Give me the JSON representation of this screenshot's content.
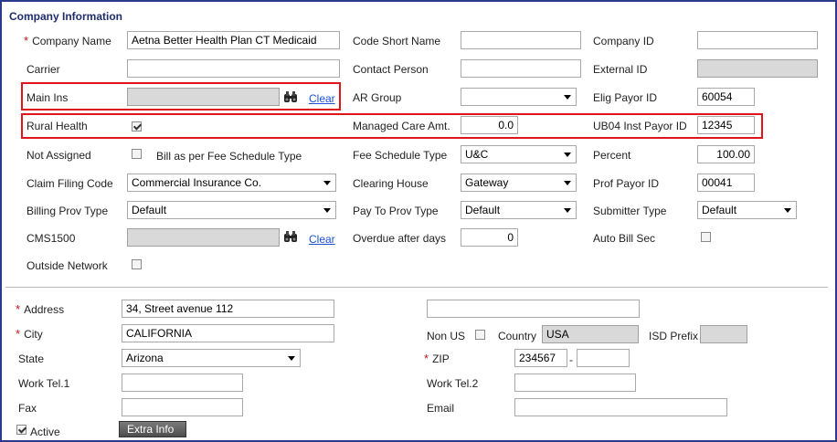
{
  "section": {
    "title": "Company Information"
  },
  "left": {
    "company_name": {
      "label": "Company Name",
      "value": "Aetna Better Health Plan CT Medicaid"
    },
    "carrier": {
      "label": "Carrier",
      "value": ""
    },
    "main_ins": {
      "label": "Main Ins",
      "clear": "Clear"
    },
    "rural_health": {
      "label": "Rural Health"
    },
    "not_assigned": {
      "label": "Not Assigned",
      "bill_label": "Bill as per Fee Schedule Type"
    },
    "claim_filing_code": {
      "label": "Claim Filing Code",
      "value": "Commercial Insurance Co."
    },
    "billing_prov_type": {
      "label": "Billing Prov Type",
      "value": "Default"
    },
    "cms1500": {
      "label": "CMS1500",
      "clear": "Clear"
    },
    "outside_network": {
      "label": "Outside Network"
    }
  },
  "middle": {
    "code_short_name": {
      "label": "Code Short Name",
      "value": ""
    },
    "contact_person": {
      "label": "Contact Person",
      "value": ""
    },
    "ar_group": {
      "label": "AR Group",
      "value": ""
    },
    "managed_care_amt": {
      "label": "Managed Care Amt.",
      "value": "0.0"
    },
    "fee_schedule_type": {
      "label": "Fee Schedule Type",
      "value": "U&C"
    },
    "clearing_house": {
      "label": "Clearing House",
      "value": "Gateway"
    },
    "pay_to_prov_type": {
      "label": "Pay To Prov Type",
      "value": "Default"
    },
    "overdue_after_days": {
      "label": "Overdue after days",
      "value": "0"
    }
  },
  "right": {
    "company_id": {
      "label": "Company ID",
      "value": ""
    },
    "external_id": {
      "label": "External ID"
    },
    "elig_payor_id": {
      "label": "Elig Payor ID",
      "value": "60054"
    },
    "ub04_inst_payor_id": {
      "label": "UB04 Inst Payor ID",
      "value": "12345"
    },
    "percent": {
      "label": "Percent",
      "value": "100.00"
    },
    "prof_payor_id": {
      "label": "Prof Payor ID",
      "value": "00041"
    },
    "submitter_type": {
      "label": "Submitter Type",
      "value": "Default"
    },
    "auto_bill_sec": {
      "label": "Auto Bill Sec"
    }
  },
  "address": {
    "address": {
      "label": "Address",
      "value": "34, Street avenue 112",
      "value2": ""
    },
    "city": {
      "label": "City",
      "value": "CALIFORNIA"
    },
    "state": {
      "label": "State",
      "value": "Arizona"
    },
    "work_tel1": {
      "label": "Work Tel.1",
      "value": ""
    },
    "fax": {
      "label": "Fax",
      "value": ""
    },
    "non_us": {
      "label": "Non US"
    },
    "country": {
      "label": "Country",
      "value": "USA"
    },
    "isd_prefix": {
      "label": "ISD Prefix"
    },
    "zip": {
      "label": "ZIP",
      "value": "234567",
      "sep": "-",
      "ext": ""
    },
    "work_tel2": {
      "label": "Work Tel.2",
      "value": ""
    },
    "email": {
      "label": "Email",
      "value": ""
    },
    "active": {
      "label": "Active"
    },
    "extra_info": {
      "label": "Extra Info"
    }
  },
  "colors": {
    "title": "#1f2d6b",
    "highlight": "#e0141b",
    "required": "#c0141b",
    "link": "#1a4fd6",
    "frame": "#2b3a8c"
  }
}
